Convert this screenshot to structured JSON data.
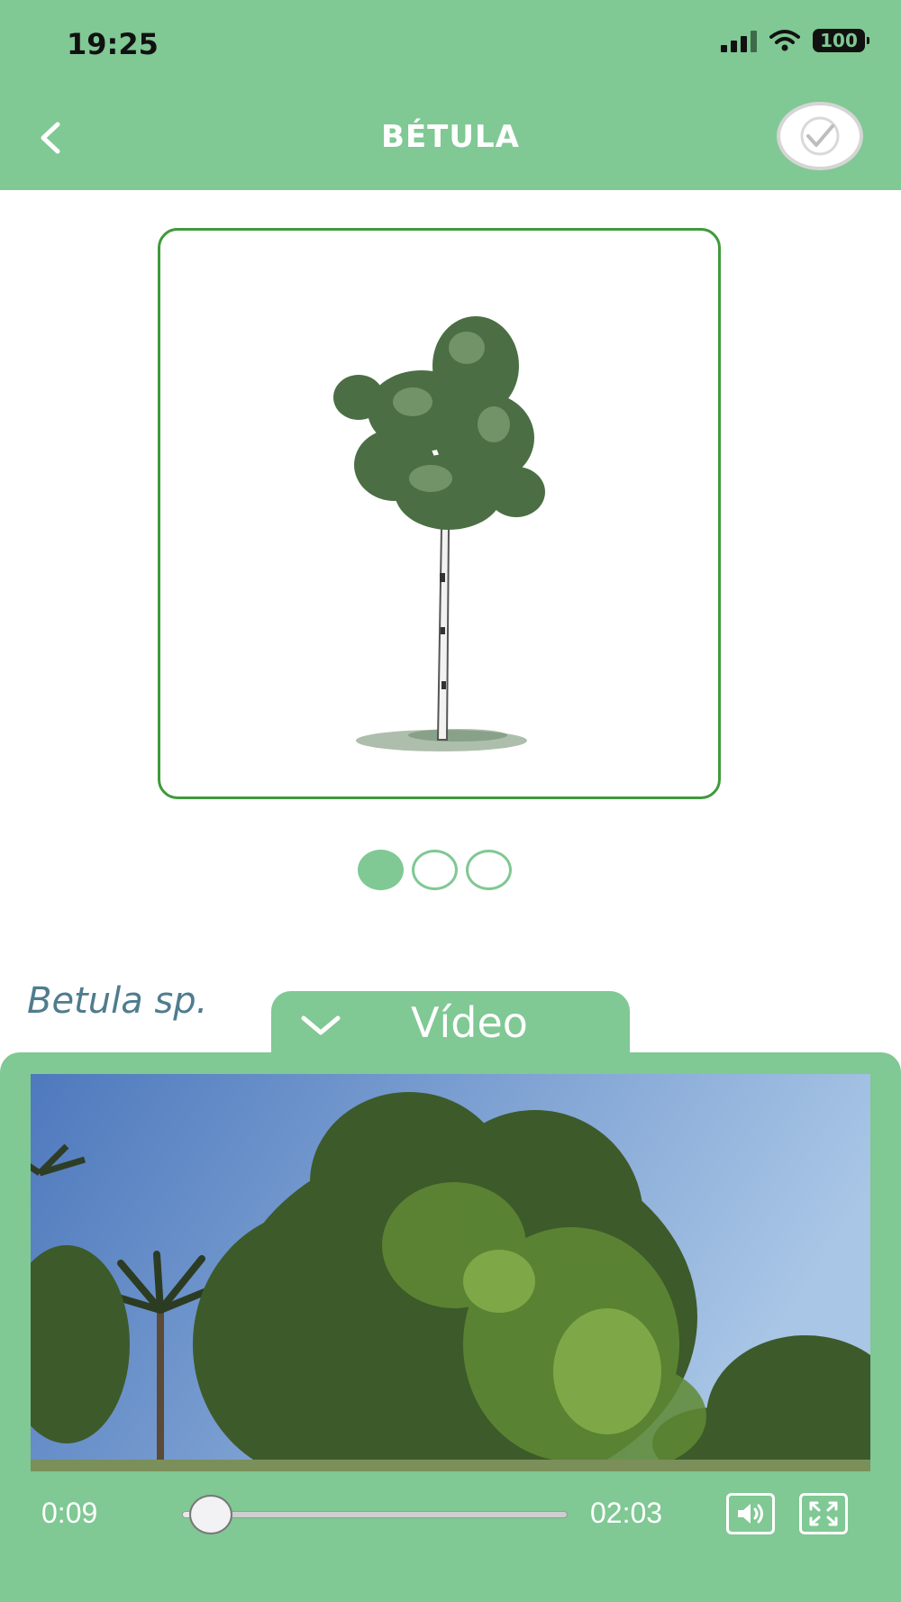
{
  "status_bar": {
    "time": "19:25",
    "battery": "100"
  },
  "header": {
    "title": "BÉTULA",
    "back_icon": "chevron-left-icon",
    "done_icon": "check-circle-icon"
  },
  "gallery": {
    "image": "birch-tree-illustration",
    "page_count": 3,
    "active_index": 0
  },
  "species": {
    "scientific_name": "Betula sp."
  },
  "video_tab": {
    "label": "Vídeo",
    "icon": "chevron-down-icon"
  },
  "video": {
    "current_time": "0:09",
    "duration": "02:03",
    "progress": 0.073,
    "controls": {
      "volume_icon": "volume-icon",
      "fullscreen_icon": "fullscreen-icon"
    }
  },
  "colors": {
    "primary": "#80c894",
    "card_border": "#3f9a3b",
    "species_text": "#4f7c8e"
  }
}
